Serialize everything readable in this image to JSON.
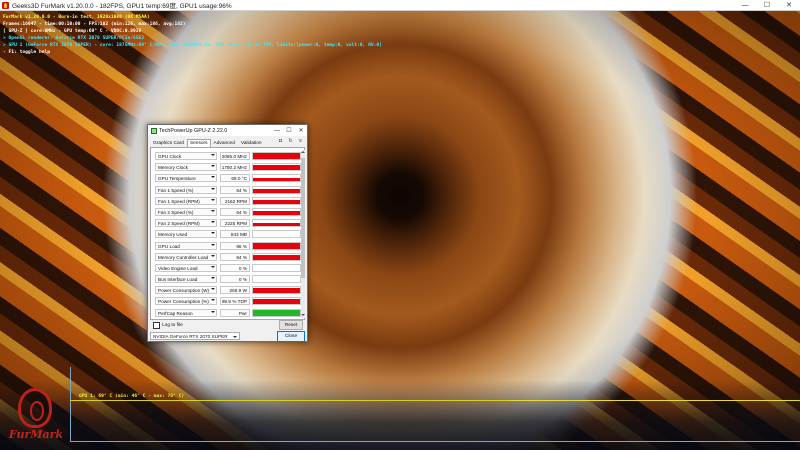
{
  "furmark_window": {
    "title": "Geeks3D FurMark v1.20.0.0 - 182FPS, GPU1 temp:69度, GPU1 usage:96%",
    "controls": [
      "—",
      "☐",
      "✕"
    ]
  },
  "overlay": {
    "line1": "FurMark v1.20.0.0 - Burn-in test, 1920x1080 (0X MSAA)",
    "line2": "Frames:16947 - time:00:10:00 - FPS:182 (min:126, max:186, avg:182)",
    "line3": "[ GPU-Z ] core:0MHz - GPU temp:69° C - VDDC:0.893V",
    "line4": "> OpenGL renderer: GeForce RTX 2070 SUPER/PCIe/SSE2",
    "line5": "> GPU 1 (GeForce RTX 2070 SUPER) - core: 1875MHz:69° C/96%, mem: 7000MHz:5%, GPU power: 98.5% TDP, limits:[power:0, temp:0, volt:0, OV:0]",
    "line6": "- F1: toggle help"
  },
  "temp_graph": {
    "label": "GPU 1: 69° C (min: 46° C - max: 70° C)"
  },
  "logo": {
    "name": "FurMark"
  },
  "gpuz": {
    "title": "TechPowerUp GPU-Z 2.22.0",
    "controls": [
      "—",
      "☐",
      "✕"
    ],
    "tabs": [
      "Graphics Card",
      "Sensors",
      "Advanced",
      "Validation"
    ],
    "tools": [
      "camera-icon",
      "refresh-icon",
      "menu-icon"
    ],
    "sensors": [
      {
        "label": "GPU Clock",
        "value": "2085.0 MHz",
        "level": 0.95,
        "color": "#e8000b"
      },
      {
        "label": "Memory Clock",
        "value": "1750.2 MHz",
        "level": 0.92,
        "color": "#e8000b"
      },
      {
        "label": "GPU Temperature",
        "value": "69.0 °C",
        "level": 0.62,
        "color": "#e8000b"
      },
      {
        "label": "Fan 1 Speed (%)",
        "value": "54 %",
        "level": 0.55,
        "color": "#e8000b"
      },
      {
        "label": "Fan 1 Speed (RPM)",
        "value": "2162 RPM",
        "level": 0.55,
        "color": "#e8000b"
      },
      {
        "label": "Fan 2 Speed (%)",
        "value": "64 %",
        "level": 0.6,
        "color": "#e8000b"
      },
      {
        "label": "Fan 2 Speed (RPM)",
        "value": "2225 RPM",
        "level": 0.6,
        "color": "#e8000b"
      },
      {
        "label": "Memory Used",
        "value": "843 MB",
        "level": 0.1,
        "color": "#e8000b"
      },
      {
        "label": "GPU Load",
        "value": "96 %",
        "level": 0.96,
        "color": "#e8000b"
      },
      {
        "label": "Memory Controller Load",
        "value": "84 %",
        "level": 0.84,
        "color": "#e8000b"
      },
      {
        "label": "Video Engine Load",
        "value": "0 %",
        "level": 0.0,
        "color": "#e8000b"
      },
      {
        "label": "Bus Interface Load",
        "value": "0 %",
        "level": 0.0,
        "color": "#e8000b"
      },
      {
        "label": "Power Consumption (W)",
        "value": "265.9 W",
        "level": 0.95,
        "color": "#e8000b"
      },
      {
        "label": "Power Consumption (%)",
        "value": "98.5 % TDP",
        "level": 0.95,
        "color": "#e8000b"
      },
      {
        "label": "PerfCap Reason",
        "value": "Pwr",
        "level": 1.0,
        "color": "#23b82a"
      }
    ],
    "log_label": "Log to file",
    "reset_label": "Reset",
    "gpu_select": "NVIDIA GeForce RTX 2070 SUPER",
    "close_label": "Close"
  }
}
